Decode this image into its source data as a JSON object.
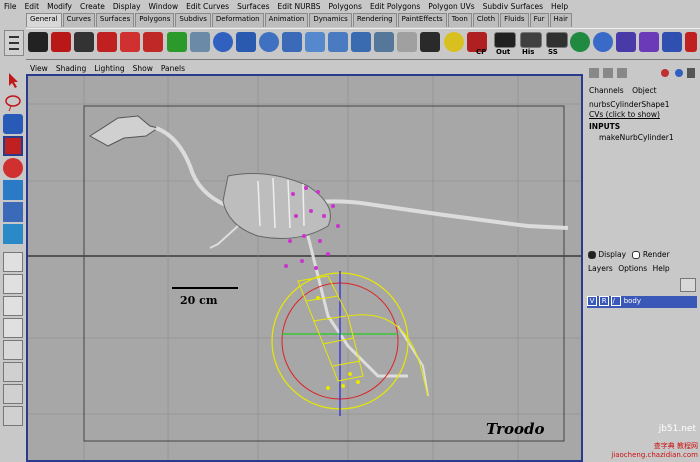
{
  "menubar": [
    "File",
    "Edit",
    "Modify",
    "Create",
    "Display",
    "Window",
    "Edit Curves",
    "Surfaces",
    "Edit NURBS",
    "Polygons",
    "Edit Polygons",
    "Polygon UVs",
    "Subdiv Surfaces",
    "Help"
  ],
  "shelf_tabs": [
    "General",
    "Curves",
    "Surfaces",
    "Polygons",
    "Subdivs",
    "Deformation",
    "Animation",
    "Dynamics",
    "Rendering",
    "PaintEffects",
    "Toon",
    "Cloth",
    "Fluids",
    "Fur",
    "Hair"
  ],
  "shelf_captions": [
    "CP",
    "Out",
    "His",
    "SS"
  ],
  "panel_menu": [
    "View",
    "Shading",
    "Lighting",
    "Show",
    "Panels"
  ],
  "channel_box": {
    "tabs": [
      "Channels",
      "Object"
    ],
    "object_name": "nurbsCylinderShape1",
    "cvs_label": "CVs (click to show)",
    "inputs_label": "INPUTS",
    "input_node": "makeNurbCylinder1"
  },
  "layer_editor": {
    "display_radio": "Display",
    "render_radio": "Render",
    "menu": [
      "Layers",
      "Options",
      "Help"
    ],
    "layer": {
      "v": "V",
      "r": "R",
      "name": "body"
    }
  },
  "viewport": {
    "scale_label": "20 cm",
    "species_label": "Troodo"
  },
  "watermark": {
    "site": "jb51.net",
    "line1": "查字典 教程网",
    "line2": "jiaocheng.chazidian.com"
  },
  "colors": {
    "viewport_bg": "#a7a7a7",
    "active_border": "#2a3a8c",
    "cv_magenta": "#cc33cc",
    "curve_yellow": "#e8e800",
    "axis_red": "#dd2222",
    "axis_green": "#22cc22",
    "axis_blue": "#2222dd",
    "layer_selected": "#3a58b8"
  }
}
